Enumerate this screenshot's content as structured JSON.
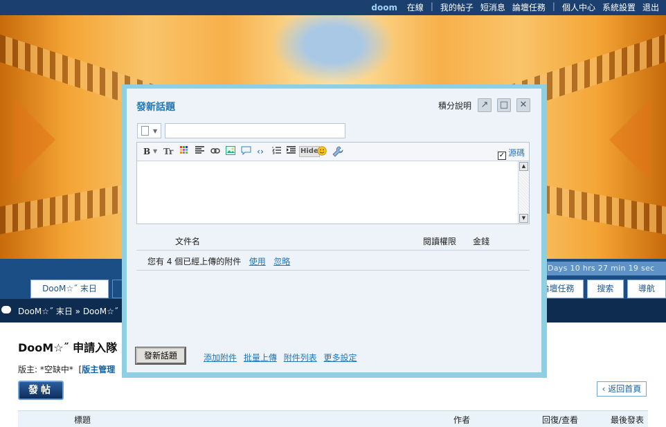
{
  "topbar": {
    "username": "doom",
    "status": "在線",
    "links": [
      "我的帖子",
      "短消息",
      "論壇任務",
      "個人中心",
      "系統設置",
      "退出"
    ]
  },
  "countdown": {
    "text": "Days 10 hrs 27 min 19 sec"
  },
  "tabs": {
    "forum": "DooM☆˝ 末日",
    "tasks": "論壇任務",
    "search": "搜索",
    "nav": "導航"
  },
  "breadcrumb": "DooM☆˝ 末日 » DooM☆˝",
  "forum": {
    "title": "DooM☆˝ 申請入隊",
    "moderators_prefix": "版主: *空缺中*",
    "moderators_open": "[",
    "moderators_link": "版主管理"
  },
  "post_button": "發帖",
  "back_home": "返回首頁",
  "table_head": {
    "title": "標題",
    "author": "作者",
    "replies": "回復/查看",
    "last": "最後發表"
  },
  "modal": {
    "title": "發新話題",
    "score_help": "積分說明",
    "popout_icon": "↗",
    "maximize_icon": "□",
    "close_icon": "✕",
    "subject_value": "",
    "toolbar": {
      "bold": "B",
      "font_size": "Tr",
      "hide": "Hide",
      "source_label": "源碼",
      "source_checked": "✓"
    },
    "attach_header": {
      "filename": "文件名",
      "read_perm": "閱讀權限",
      "price": "金錢"
    },
    "attach_notice_pre": "您有 4 個已經上傳的附件",
    "attach_use": "使用",
    "attach_ignore": "忽略",
    "submit": "發新話題",
    "footer_links": [
      "添加附件",
      "批量上傳",
      "附件列表",
      "更多設定"
    ]
  }
}
